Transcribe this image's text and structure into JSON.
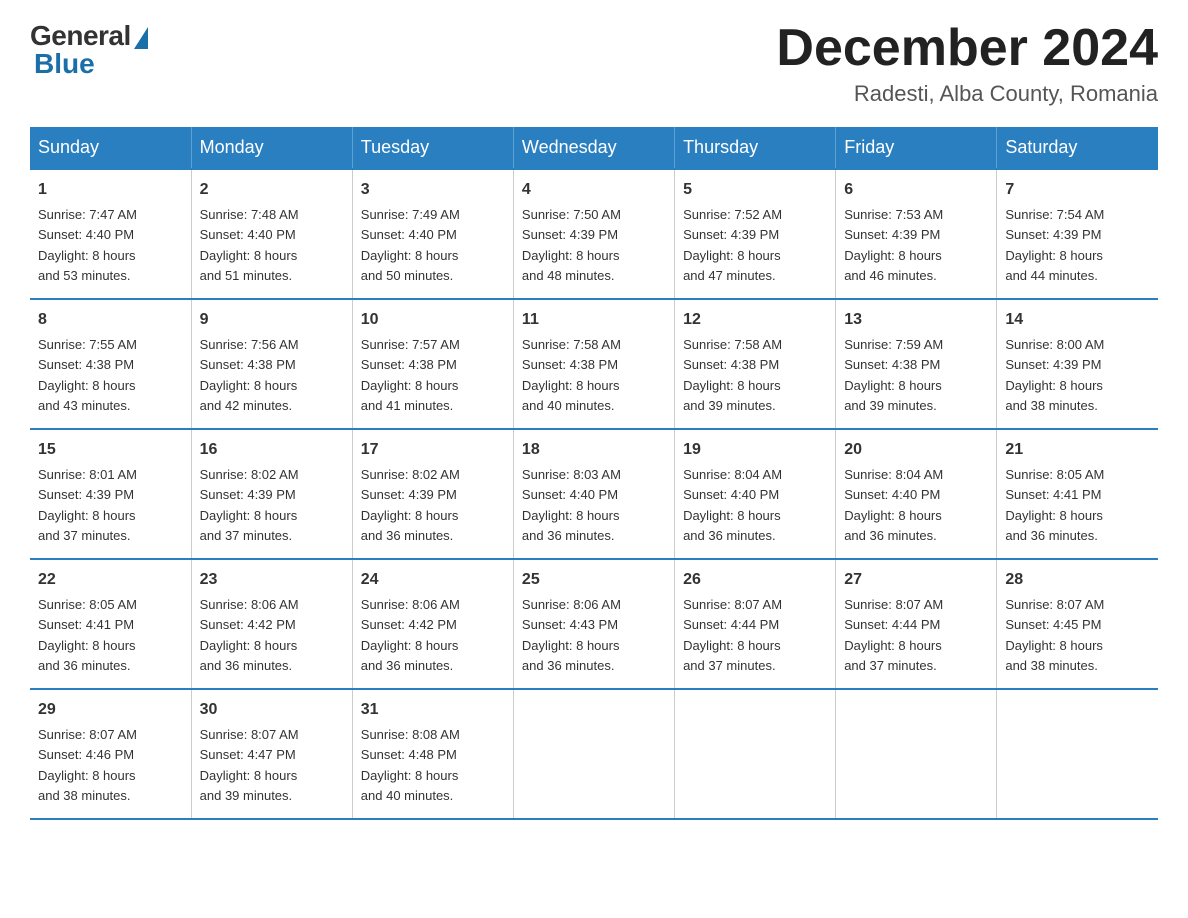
{
  "logo": {
    "general": "General",
    "blue": "Blue"
  },
  "title": "December 2024",
  "location": "Radesti, Alba County, Romania",
  "days_header": [
    "Sunday",
    "Monday",
    "Tuesday",
    "Wednesday",
    "Thursday",
    "Friday",
    "Saturday"
  ],
  "weeks": [
    [
      {
        "day": "1",
        "sunrise": "7:47 AM",
        "sunset": "4:40 PM",
        "daylight": "8 hours and 53 minutes."
      },
      {
        "day": "2",
        "sunrise": "7:48 AM",
        "sunset": "4:40 PM",
        "daylight": "8 hours and 51 minutes."
      },
      {
        "day": "3",
        "sunrise": "7:49 AM",
        "sunset": "4:40 PM",
        "daylight": "8 hours and 50 minutes."
      },
      {
        "day": "4",
        "sunrise": "7:50 AM",
        "sunset": "4:39 PM",
        "daylight": "8 hours and 48 minutes."
      },
      {
        "day": "5",
        "sunrise": "7:52 AM",
        "sunset": "4:39 PM",
        "daylight": "8 hours and 47 minutes."
      },
      {
        "day": "6",
        "sunrise": "7:53 AM",
        "sunset": "4:39 PM",
        "daylight": "8 hours and 46 minutes."
      },
      {
        "day": "7",
        "sunrise": "7:54 AM",
        "sunset": "4:39 PM",
        "daylight": "8 hours and 44 minutes."
      }
    ],
    [
      {
        "day": "8",
        "sunrise": "7:55 AM",
        "sunset": "4:38 PM",
        "daylight": "8 hours and 43 minutes."
      },
      {
        "day": "9",
        "sunrise": "7:56 AM",
        "sunset": "4:38 PM",
        "daylight": "8 hours and 42 minutes."
      },
      {
        "day": "10",
        "sunrise": "7:57 AM",
        "sunset": "4:38 PM",
        "daylight": "8 hours and 41 minutes."
      },
      {
        "day": "11",
        "sunrise": "7:58 AM",
        "sunset": "4:38 PM",
        "daylight": "8 hours and 40 minutes."
      },
      {
        "day": "12",
        "sunrise": "7:58 AM",
        "sunset": "4:38 PM",
        "daylight": "8 hours and 39 minutes."
      },
      {
        "day": "13",
        "sunrise": "7:59 AM",
        "sunset": "4:38 PM",
        "daylight": "8 hours and 39 minutes."
      },
      {
        "day": "14",
        "sunrise": "8:00 AM",
        "sunset": "4:39 PM",
        "daylight": "8 hours and 38 minutes."
      }
    ],
    [
      {
        "day": "15",
        "sunrise": "8:01 AM",
        "sunset": "4:39 PM",
        "daylight": "8 hours and 37 minutes."
      },
      {
        "day": "16",
        "sunrise": "8:02 AM",
        "sunset": "4:39 PM",
        "daylight": "8 hours and 37 minutes."
      },
      {
        "day": "17",
        "sunrise": "8:02 AM",
        "sunset": "4:39 PM",
        "daylight": "8 hours and 36 minutes."
      },
      {
        "day": "18",
        "sunrise": "8:03 AM",
        "sunset": "4:40 PM",
        "daylight": "8 hours and 36 minutes."
      },
      {
        "day": "19",
        "sunrise": "8:04 AM",
        "sunset": "4:40 PM",
        "daylight": "8 hours and 36 minutes."
      },
      {
        "day": "20",
        "sunrise": "8:04 AM",
        "sunset": "4:40 PM",
        "daylight": "8 hours and 36 minutes."
      },
      {
        "day": "21",
        "sunrise": "8:05 AM",
        "sunset": "4:41 PM",
        "daylight": "8 hours and 36 minutes."
      }
    ],
    [
      {
        "day": "22",
        "sunrise": "8:05 AM",
        "sunset": "4:41 PM",
        "daylight": "8 hours and 36 minutes."
      },
      {
        "day": "23",
        "sunrise": "8:06 AM",
        "sunset": "4:42 PM",
        "daylight": "8 hours and 36 minutes."
      },
      {
        "day": "24",
        "sunrise": "8:06 AM",
        "sunset": "4:42 PM",
        "daylight": "8 hours and 36 minutes."
      },
      {
        "day": "25",
        "sunrise": "8:06 AM",
        "sunset": "4:43 PM",
        "daylight": "8 hours and 36 minutes."
      },
      {
        "day": "26",
        "sunrise": "8:07 AM",
        "sunset": "4:44 PM",
        "daylight": "8 hours and 37 minutes."
      },
      {
        "day": "27",
        "sunrise": "8:07 AM",
        "sunset": "4:44 PM",
        "daylight": "8 hours and 37 minutes."
      },
      {
        "day": "28",
        "sunrise": "8:07 AM",
        "sunset": "4:45 PM",
        "daylight": "8 hours and 38 minutes."
      }
    ],
    [
      {
        "day": "29",
        "sunrise": "8:07 AM",
        "sunset": "4:46 PM",
        "daylight": "8 hours and 38 minutes."
      },
      {
        "day": "30",
        "sunrise": "8:07 AM",
        "sunset": "4:47 PM",
        "daylight": "8 hours and 39 minutes."
      },
      {
        "day": "31",
        "sunrise": "8:08 AM",
        "sunset": "4:48 PM",
        "daylight": "8 hours and 40 minutes."
      },
      null,
      null,
      null,
      null
    ]
  ],
  "labels": {
    "sunrise": "Sunrise:",
    "sunset": "Sunset:",
    "daylight": "Daylight:"
  }
}
